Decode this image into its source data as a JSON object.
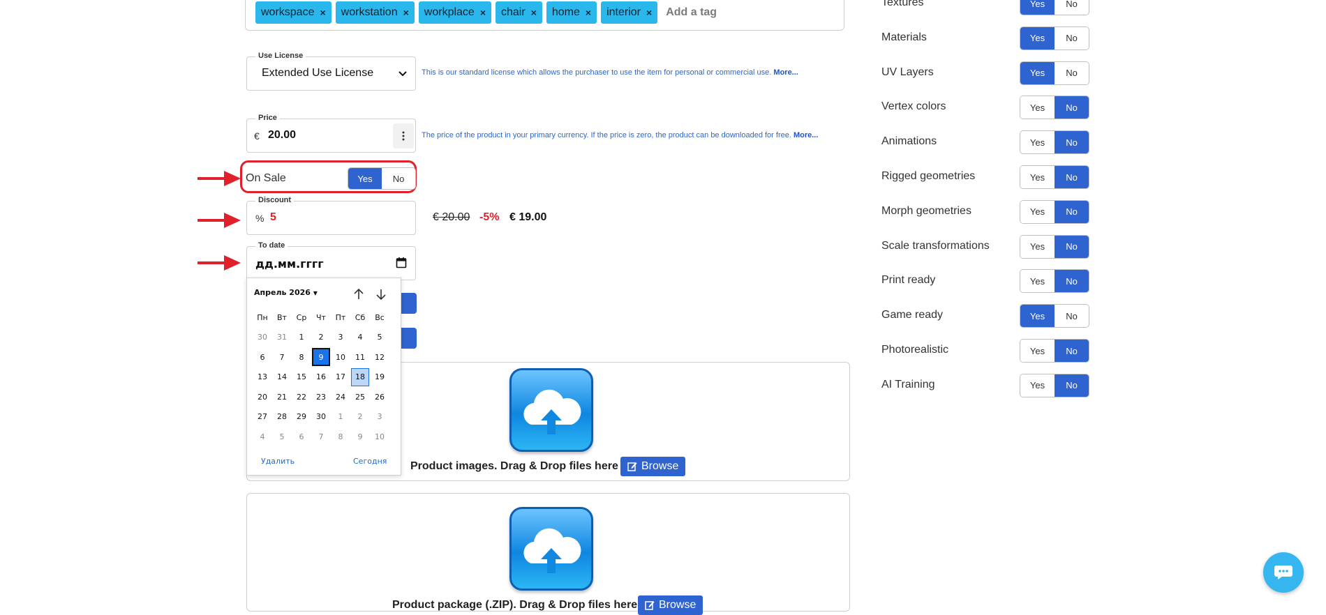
{
  "tags": {
    "items": [
      "workspace",
      "workstation",
      "workplace",
      "chair",
      "home",
      "interior"
    ],
    "remove_glyph": "×",
    "placeholder": "Add a tag"
  },
  "license": {
    "legend": "Use License",
    "value": "Extended Use License",
    "help": "This is our standard license which allows the purchaser to use the item for personal or commercial use.",
    "more": "More..."
  },
  "price": {
    "legend": "Price",
    "currency": "€",
    "value": "20.00",
    "help": "The price of the product in your primary currency. If the price is zero, the product can be downloaded for free.",
    "more": "More..."
  },
  "on_sale": {
    "label": "On Sale",
    "yes": "Yes",
    "no": "No",
    "selected": "Yes"
  },
  "discount": {
    "legend": "Discount",
    "unit": "%",
    "value": "5",
    "old_price": "€ 20.00",
    "percent": "-5%",
    "new_price": "€ 19.00"
  },
  "to_date": {
    "legend": "To date",
    "placeholder": "дд.мм.гггг"
  },
  "calendar": {
    "month_label": "Апрель 2026",
    "weekdays": [
      "Пн",
      "Вт",
      "Ср",
      "Чт",
      "Пт",
      "Сб",
      "Вс"
    ],
    "days": [
      "30",
      "31",
      "1",
      "2",
      "3",
      "4",
      "5",
      "6",
      "7",
      "8",
      "9",
      "10",
      "11",
      "12",
      "13",
      "14",
      "15",
      "16",
      "17",
      "18",
      "19",
      "20",
      "21",
      "22",
      "23",
      "24",
      "25",
      "26",
      "27",
      "28",
      "29",
      "30",
      "1",
      "2",
      "3",
      "4",
      "5",
      "6",
      "7",
      "8",
      "9",
      "10"
    ],
    "selected_day": "9",
    "today_day": "18",
    "clear": "Удалить",
    "today": "Сегодня"
  },
  "uploads": {
    "images_text": "Product images. Drag & Drop files here or",
    "package_text": "Product package (.ZIP). Drag & Drop files here or",
    "browse": "Browse"
  },
  "features": [
    {
      "label": "Textures",
      "value": "Yes"
    },
    {
      "label": "Materials",
      "value": "Yes"
    },
    {
      "label": "UV Layers",
      "value": "Yes"
    },
    {
      "label": "Vertex colors",
      "value": "No"
    },
    {
      "label": "Animations",
      "value": "No"
    },
    {
      "label": "Rigged geometries",
      "value": "No"
    },
    {
      "label": "Morph geometries",
      "value": "No"
    },
    {
      "label": "Scale transformations",
      "value": "No"
    },
    {
      "label": "Print ready",
      "value": "No"
    },
    {
      "label": "Game ready",
      "value": "Yes"
    },
    {
      "label": "Photorealistic",
      "value": "No"
    },
    {
      "label": "AI Training",
      "value": "No"
    }
  ],
  "feature_yes": "Yes",
  "feature_no": "No",
  "colors": {
    "accent": "#2f63cf",
    "tag": "#2ab7eb",
    "highlight": "#e0202b",
    "chat": "#36b6ef"
  }
}
